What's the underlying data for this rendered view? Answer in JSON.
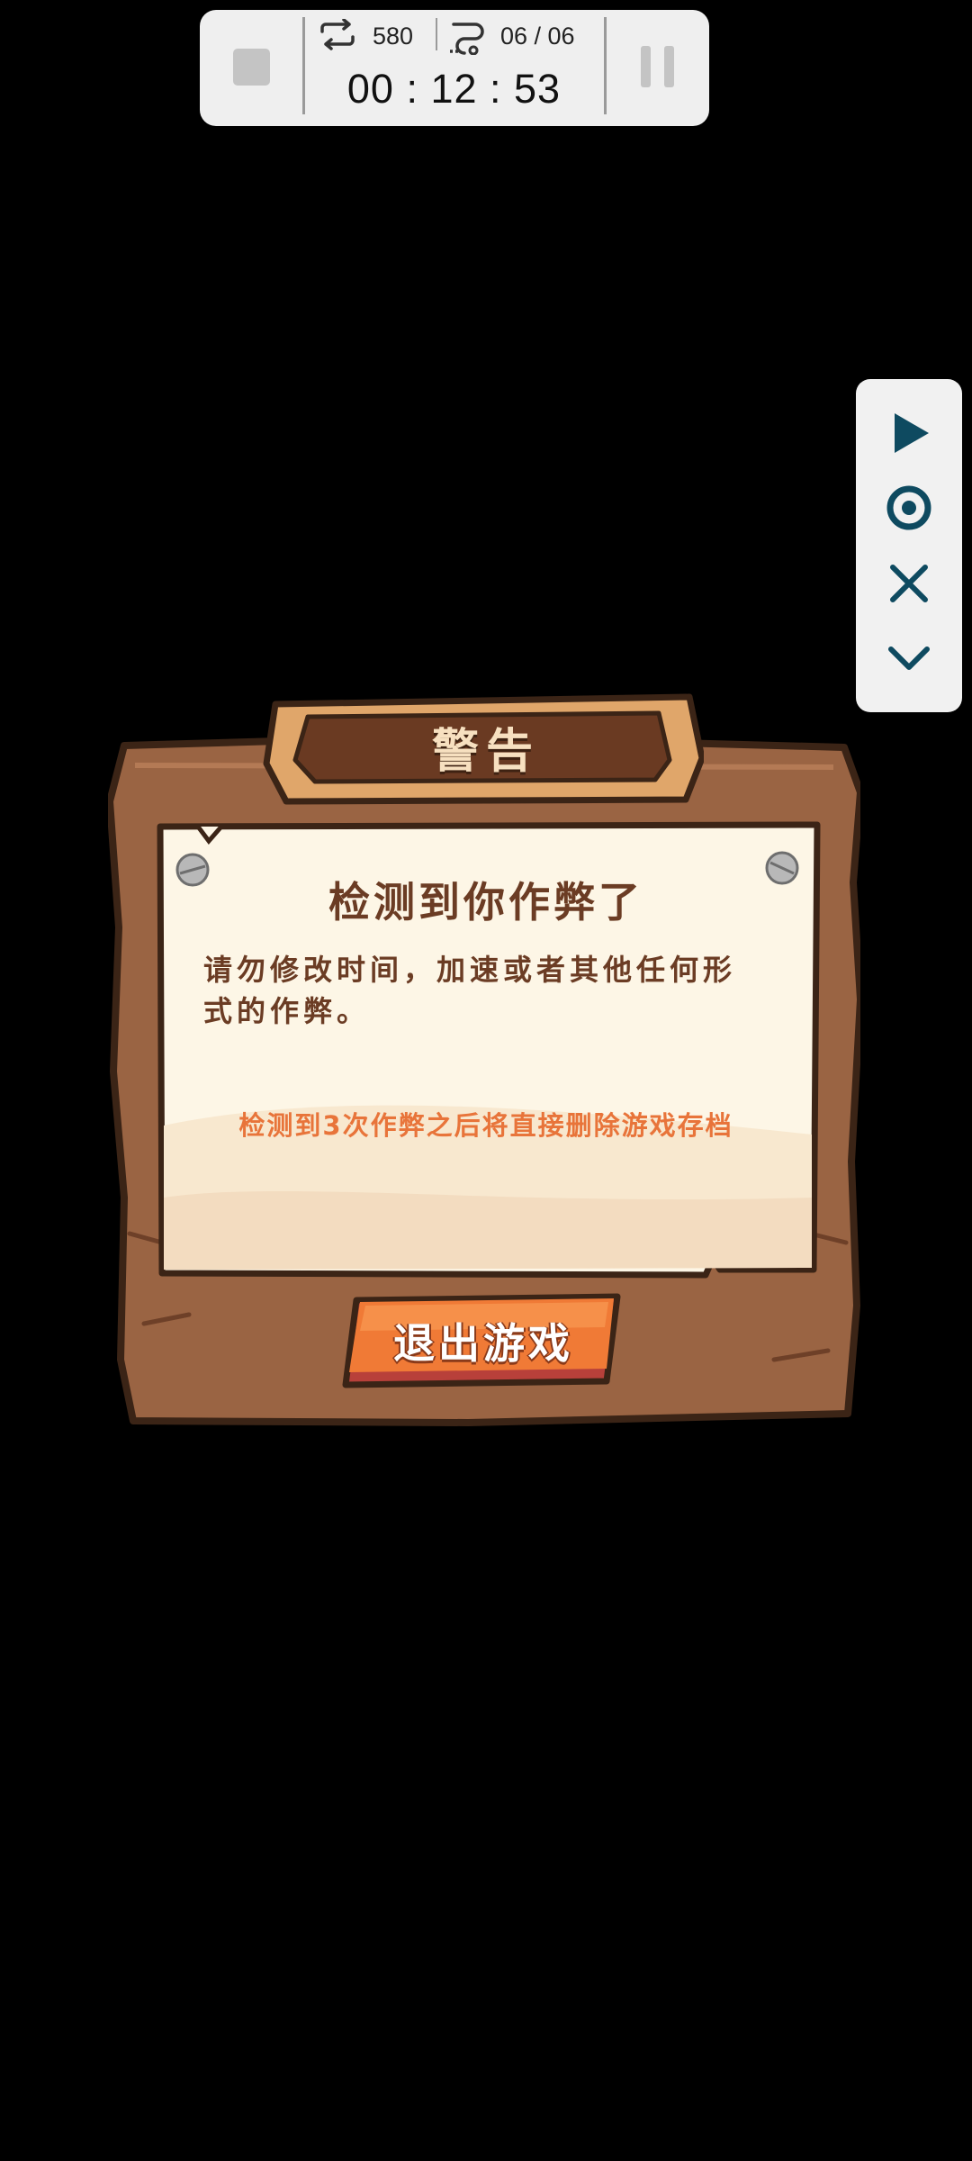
{
  "recorder": {
    "loop_count": "580",
    "segments": "06 / 06",
    "time": "00 : 12 : 53"
  },
  "side_panel": {
    "icons": [
      "play-icon",
      "record-target-icon",
      "close-icon",
      "chevron-down-icon"
    ],
    "accent": "#0e4a60"
  },
  "dialog": {
    "banner_title": "警告",
    "title": "检测到你作弊了",
    "body": "请勿修改时间，加速或者其他任何形式的作弊。",
    "warning": "检测到3次作弊之后将直接删除游戏存档",
    "exit_button": "退出游戏",
    "colors": {
      "wood": "#9a6443",
      "paper": "#fdf6e6",
      "text": "#6b3c24",
      "warning_text": "#e8743a",
      "button": "#f07a36"
    }
  }
}
